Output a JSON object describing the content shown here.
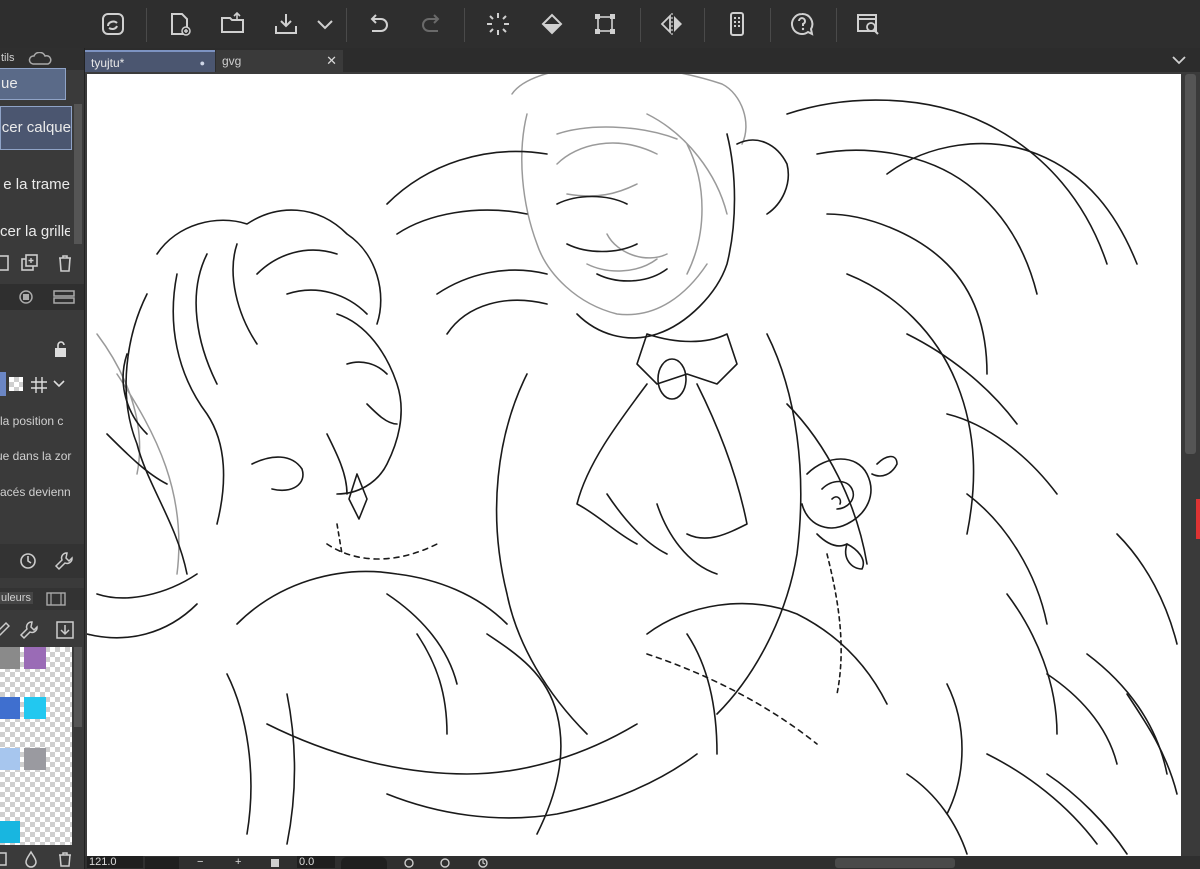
{
  "toolbar": {
    "icons": [
      "app-logo-icon",
      "new-file-icon",
      "open-folder-icon",
      "save-icon",
      "dropdown-chevron-icon",
      "undo-icon",
      "redo-icon",
      "clear-loading-icon",
      "fill-icon",
      "transform-icon",
      "flip-horizontal-icon",
      "smartphone-icon",
      "help-icon",
      "window-search-icon"
    ]
  },
  "left_panel": {
    "tab_top": "tils",
    "layer_items": [
      "ue",
      "cer calque",
      "e la trame",
      "cer la grille"
    ],
    "options_text": [
      "la position c",
      "ue dans la zor",
      "acés devienn"
    ],
    "color_tab": "uleurs",
    "swatch_colors": [
      "#8a8a8a",
      "#9a6bb6",
      "#3f6fcf",
      "#22c8f0",
      "#a7c6ee",
      "#9a9aa0",
      "#18b6e0"
    ]
  },
  "tabs": [
    {
      "label": "tyujtu*",
      "modified_dot": "●"
    },
    {
      "label": "gvg",
      "close": "✕"
    }
  ],
  "tabbar": {
    "menu_chevron": "⌵"
  },
  "status": {
    "zoom": "121.0",
    "angle": "0.0",
    "minus": "−",
    "plus": "+"
  }
}
